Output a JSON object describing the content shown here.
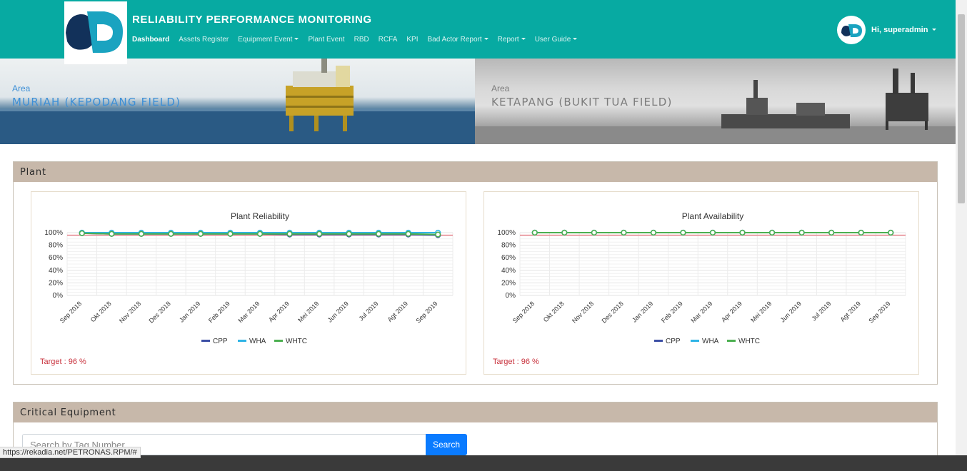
{
  "header": {
    "title": "RELIABILITY PERFORMANCE MONITORING",
    "menu": [
      {
        "label": "Dashboard",
        "active": true,
        "dropdown": false
      },
      {
        "label": "Assets Register",
        "active": false,
        "dropdown": false
      },
      {
        "label": "Equipment Event",
        "active": false,
        "dropdown": true
      },
      {
        "label": "Plant Event",
        "active": false,
        "dropdown": false
      },
      {
        "label": "RBD",
        "active": false,
        "dropdown": false
      },
      {
        "label": "RCFA",
        "active": false,
        "dropdown": false
      },
      {
        "label": "KPI",
        "active": false,
        "dropdown": false
      },
      {
        "label": "Bad Actor Report",
        "active": false,
        "dropdown": true
      },
      {
        "label": "Report",
        "active": false,
        "dropdown": true
      },
      {
        "label": "User Guide",
        "active": false,
        "dropdown": true
      }
    ],
    "user_greeting": "Hi, superadmin",
    "colors": {
      "primary": "#07aaa2",
      "logo_dark": "#12315a",
      "logo_light": "#1aa3c0"
    }
  },
  "areas": [
    {
      "label": "Area",
      "name": "MURIAH (KEPODANG FIELD)"
    },
    {
      "label": "Area",
      "name": "KETAPANG (BUKIT TUA FIELD)"
    }
  ],
  "plant": {
    "title": "Plant",
    "target_text": "Target : 96 %"
  },
  "critical": {
    "title": "Critical Equipment",
    "search_placeholder": "Search by Tag Number",
    "search_button": "Search"
  },
  "status_url": "https://rekadia.net/PETRONAS.RPM/#",
  "chart_data": [
    {
      "type": "line",
      "title": "Plant Reliability",
      "categories": [
        "Sep 2018",
        "Okt 2018",
        "Nov 2018",
        "Des 2018",
        "Jan 2019",
        "Feb 2019",
        "Mar 2019",
        "Apr 2019",
        "Mei 2019",
        "Jun 2019",
        "Jul 2019",
        "Agt 2019",
        "Sep 2019"
      ],
      "yticks": [
        "100%",
        "80%",
        "60%",
        "40%",
        "20%",
        "0%"
      ],
      "ylim": [
        0,
        100
      ],
      "target": 96,
      "legend_position": "bottom",
      "series": [
        {
          "name": "CPP",
          "color": "#3c4fa5",
          "values": [
            99,
            98,
            98,
            98,
            98,
            98,
            98,
            97,
            97,
            97,
            97,
            97,
            96
          ]
        },
        {
          "name": "WHA",
          "color": "#2fb4e6",
          "values": [
            100,
            100,
            100,
            100,
            100,
            100,
            100,
            100,
            100,
            100,
            100,
            100,
            100
          ]
        },
        {
          "name": "WHTC",
          "color": "#4caf50",
          "values": [
            99,
            98,
            98,
            98,
            98,
            98,
            98,
            98,
            98,
            98,
            98,
            98,
            97
          ]
        }
      ]
    },
    {
      "type": "line",
      "title": "Plant Availability",
      "categories": [
        "Sep 2018",
        "Okt 2018",
        "Nov 2018",
        "Des 2018",
        "Jan 2019",
        "Feb 2019",
        "Mar 2019",
        "Apr 2019",
        "Mei 2019",
        "Jun 2019",
        "Jul 2019",
        "Agt 2019",
        "Sep 2019"
      ],
      "yticks": [
        "100%",
        "80%",
        "60%",
        "40%",
        "20%",
        "0%"
      ],
      "ylim": [
        0,
        100
      ],
      "target": 96,
      "legend_position": "bottom",
      "series": [
        {
          "name": "CPP",
          "color": "#3c4fa5",
          "values": [
            100,
            100,
            100,
            100,
            100,
            100,
            100,
            100,
            100,
            100,
            100,
            100,
            100
          ]
        },
        {
          "name": "WHA",
          "color": "#2fb4e6",
          "values": [
            100,
            100,
            100,
            100,
            100,
            100,
            100,
            100,
            100,
            100,
            100,
            100,
            100
          ]
        },
        {
          "name": "WHTC",
          "color": "#4caf50",
          "values": [
            100,
            100,
            100,
            100,
            100,
            100,
            100,
            100,
            100,
            100,
            100,
            100,
            100
          ]
        }
      ]
    }
  ]
}
